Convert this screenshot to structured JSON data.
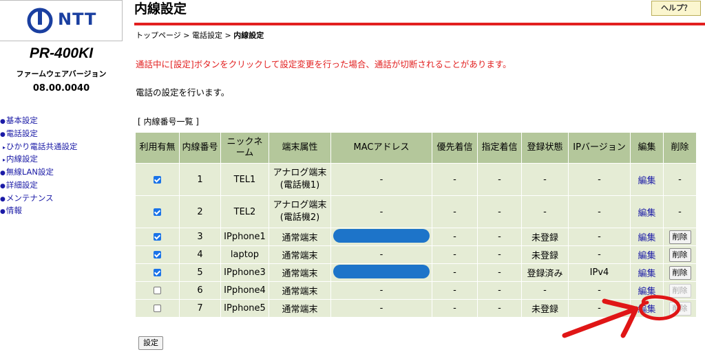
{
  "brand": {
    "logo_text": "NTT",
    "model": "PR-400KI",
    "fw_label": "ファームウェアバージョン",
    "fw_version": "08.00.0040"
  },
  "nav": {
    "items": [
      {
        "label": "基本設定",
        "sub": false
      },
      {
        "label": "電話設定",
        "sub": false
      },
      {
        "label": "ひかり電話共通設定",
        "sub": true
      },
      {
        "label": "内線設定",
        "sub": true
      },
      {
        "label": "無線LAN設定",
        "sub": false
      },
      {
        "label": "詳細設定",
        "sub": false
      },
      {
        "label": "メンテナンス",
        "sub": false
      },
      {
        "label": "情報",
        "sub": false
      }
    ]
  },
  "header": {
    "title": "内線設定",
    "help_label": "ヘルプ？"
  },
  "breadcrumb": {
    "top": "トップページ",
    "sep": " > ",
    "phone": "電話設定",
    "current": "内線設定"
  },
  "warning": "通話中に[設定]ボタンをクリックして設定変更を行った場合、通話が切断されることがあります。",
  "description": "電話の設定を行います。",
  "section_title": "[ 内線番号一覧 ]",
  "table": {
    "headers": [
      "利用有無",
      "内線番号",
      "ニックネーム",
      "端末属性",
      "MACアドレス",
      "優先着信",
      "指定着信",
      "登録状態",
      "IPバージョン",
      "編集",
      "削除"
    ],
    "rows": [
      {
        "enabled": true,
        "number": "1",
        "nickname": "TEL1",
        "attr1": "アナログ端末",
        "attr2": "(電話機1)",
        "mac": "-",
        "mac_hidden": false,
        "priority": "-",
        "designated": "-",
        "status": "-",
        "ipver": "-",
        "edit": "編集",
        "delete": "-",
        "del_btn": false,
        "del_disabled": false
      },
      {
        "enabled": true,
        "number": "2",
        "nickname": "TEL2",
        "attr1": "アナログ端末",
        "attr2": "(電話機2)",
        "mac": "-",
        "mac_hidden": false,
        "priority": "-",
        "designated": "-",
        "status": "-",
        "ipver": "-",
        "edit": "編集",
        "delete": "-",
        "del_btn": false,
        "del_disabled": false
      },
      {
        "enabled": true,
        "number": "3",
        "nickname": "IPphone1",
        "attr1": "通常端末",
        "attr2": "",
        "mac": "",
        "mac_hidden": true,
        "priority": "-",
        "designated": "-",
        "status": "未登録",
        "ipver": "-",
        "edit": "編集",
        "delete": "削除",
        "del_btn": true,
        "del_disabled": false
      },
      {
        "enabled": true,
        "number": "4",
        "nickname": "laptop",
        "attr1": "通常端末",
        "attr2": "",
        "mac": "-",
        "mac_hidden": false,
        "priority": "-",
        "designated": "-",
        "status": "未登録",
        "ipver": "-",
        "edit": "編集",
        "delete": "削除",
        "del_btn": true,
        "del_disabled": false
      },
      {
        "enabled": true,
        "number": "5",
        "nickname": "IPphone3",
        "attr1": "通常端末",
        "attr2": "",
        "mac": "",
        "mac_hidden": true,
        "priority": "-",
        "designated": "-",
        "status": "登録済み",
        "ipver": "IPv4",
        "edit": "編集",
        "delete": "削除",
        "del_btn": true,
        "del_disabled": false
      },
      {
        "enabled": false,
        "number": "6",
        "nickname": "IPphone4",
        "attr1": "通常端末",
        "attr2": "",
        "mac": "-",
        "mac_hidden": false,
        "priority": "-",
        "designated": "-",
        "status": "-",
        "ipver": "-",
        "edit": "編集",
        "delete": "削除",
        "del_btn": true,
        "del_disabled": true
      },
      {
        "enabled": false,
        "number": "7",
        "nickname": "IPphone5",
        "attr1": "通常端末",
        "attr2": "",
        "mac": "-",
        "mac_hidden": false,
        "priority": "-",
        "designated": "-",
        "status": "未登録",
        "ipver": "-",
        "edit": "編集",
        "delete": "削除",
        "del_btn": true,
        "del_disabled": true
      }
    ]
  },
  "submit_label": "設定",
  "colors": {
    "accent_red": "#e21f1f",
    "header_green": "#b4c79b",
    "row_green": "#e5ecd5",
    "link_blue": "#1a1aa6",
    "logo_blue": "#1a3fa0",
    "redaction_blue": "#1d74c9"
  }
}
